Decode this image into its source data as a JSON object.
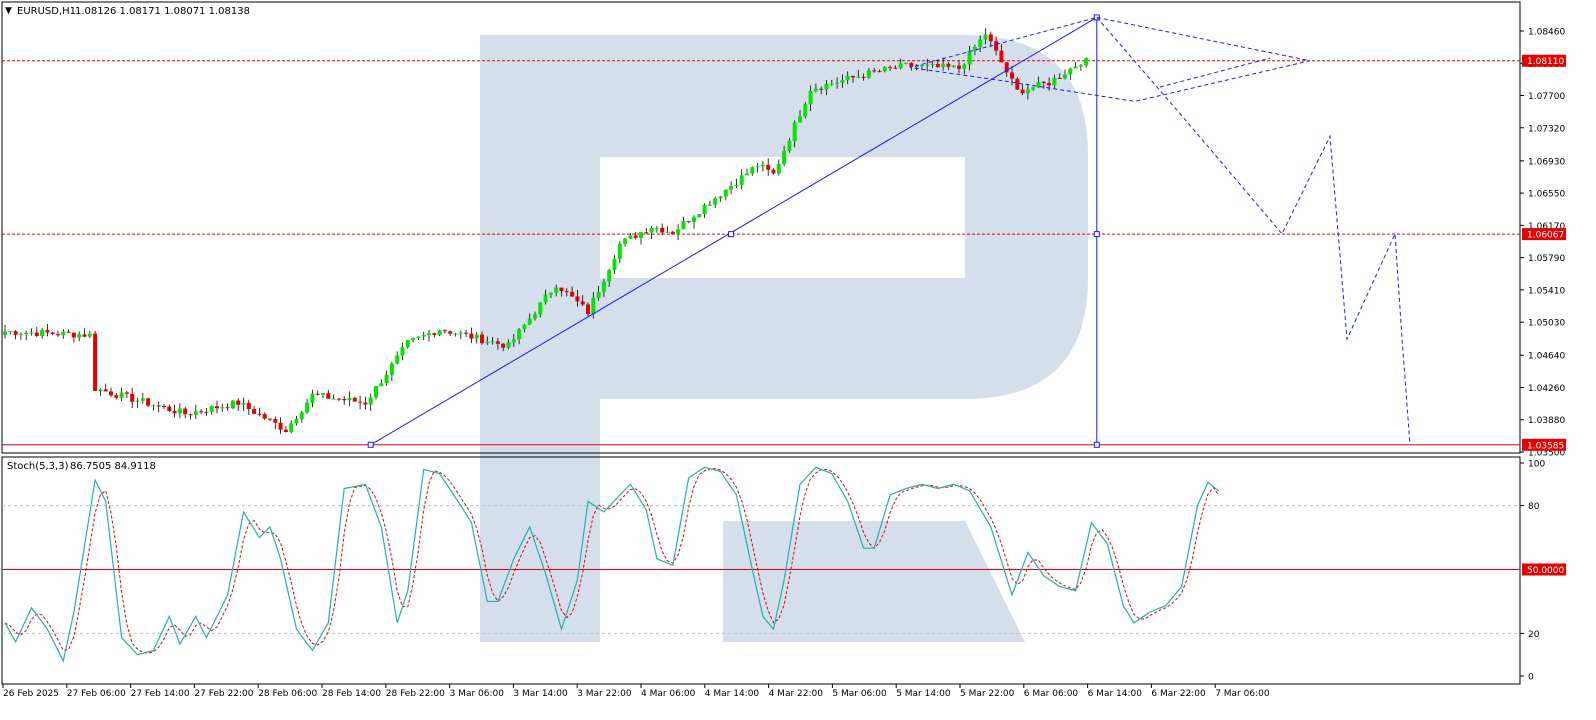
{
  "symbol_header": {
    "symbol": "EURUSD,H1",
    "ohlc": "1.08126 1.08171 1.08071 1.08138"
  },
  "stoch_header": {
    "label": "Stoch(5,3,3)",
    "values": "86.7505 84.9118"
  },
  "price_ticks": [
    "1.08460",
    "1.08080",
    "1.07700",
    "1.07320",
    "1.06930",
    "1.06550",
    "1.06170",
    "1.05790",
    "1.05410",
    "1.05030",
    "1.04640",
    "1.04260",
    "1.03880",
    "1.03500"
  ],
  "price_tick_values": [
    1.0846,
    1.0808,
    1.077,
    1.0732,
    1.0693,
    1.0655,
    1.0617,
    1.0579,
    1.0541,
    1.0503,
    1.0464,
    1.0426,
    1.0388,
    1.035
  ],
  "price_levels": [
    {
      "label": "1.08110",
      "value": 1.0811,
      "color": "#e60000"
    },
    {
      "label": "1.06067",
      "value": 1.06067,
      "color": "#e60000"
    },
    {
      "label": "1.03585",
      "value": 1.03585,
      "color": "#e60000"
    }
  ],
  "stoch_ticks": [
    "100",
    "80",
    "20",
    "0"
  ],
  "stoch_tick_values": [
    100,
    80,
    20,
    0
  ],
  "stoch_mid_label": "50.0000",
  "time_labels": [
    "26 Feb 2025",
    "27 Feb 06:00",
    "27 Feb 14:00",
    "27 Feb 22:00",
    "28 Feb 06:00",
    "28 Feb 14:00",
    "28 Feb 22:00",
    "3 Mar 06:00",
    "3 Mar 14:00",
    "3 Mar 22:00",
    "4 Mar 06:00",
    "4 Mar 14:00",
    "4 Mar 22:00",
    "5 Mar 06:00",
    "5 Mar 14:00",
    "5 Mar 22:00",
    "6 Mar 06:00",
    "6 Mar 14:00",
    "6 Mar 22:00",
    "7 Mar 06:00"
  ],
  "colors": {
    "bull": "#00e600",
    "bear": "#e60000",
    "trend": "#1a1aff",
    "stoch_main": "#20b2aa",
    "stoch_signal": "#e60000",
    "watermark": "#d5dfec"
  },
  "chart_data": {
    "type": "candlestick",
    "symbol": "EURUSD",
    "timeframe": "H1",
    "price_axis_range": [
      1.035,
      1.0862
    ],
    "key_points": [
      {
        "time": "28 Feb 17:00",
        "price": 1.03585
      },
      {
        "time": "4 Mar 18:00",
        "price": 1.06067
      },
      {
        "time": "6 Mar 11:00",
        "price": 1.0862
      }
    ],
    "forecast_path": [
      1.0811,
      1.0735,
      1.0607,
      1.0722,
      1.0483,
      1.0607,
      1.0484,
      1.0359
    ],
    "close_path_anchors": [
      {
        "bar": 0,
        "close": 1.0492
      },
      {
        "bar": 16,
        "close": 1.0488
      },
      {
        "bar": 17,
        "close": 1.0425
      },
      {
        "bar": 34,
        "close": 1.0395
      },
      {
        "bar": 44,
        "close": 1.0408
      },
      {
        "bar": 53,
        "close": 1.0376
      },
      {
        "bar": 58,
        "close": 1.0417
      },
      {
        "bar": 68,
        "close": 1.0408
      },
      {
        "bar": 76,
        "close": 1.0478
      },
      {
        "bar": 82,
        "close": 1.0495
      },
      {
        "bar": 95,
        "close": 1.0475
      },
      {
        "bar": 104,
        "close": 1.0548
      },
      {
        "bar": 110,
        "close": 1.0515
      },
      {
        "bar": 116,
        "close": 1.0595
      },
      {
        "bar": 122,
        "close": 1.0616
      },
      {
        "bar": 126,
        "close": 1.0609
      },
      {
        "bar": 133,
        "close": 1.0645
      },
      {
        "bar": 142,
        "close": 1.0688
      },
      {
        "bar": 145,
        "close": 1.0677
      },
      {
        "bar": 152,
        "close": 1.0778
      },
      {
        "bar": 163,
        "close": 1.0796
      },
      {
        "bar": 170,
        "close": 1.0805
      },
      {
        "bar": 180,
        "close": 1.0802
      },
      {
        "bar": 185,
        "close": 1.0843
      },
      {
        "bar": 191,
        "close": 1.0775
      },
      {
        "bar": 197,
        "close": 1.0785
      },
      {
        "bar": 204,
        "close": 1.0814
      }
    ],
    "stoch_axis_range": [
      0,
      100
    ],
    "stoch_levels": [
      80,
      50,
      20
    ],
    "stoch_last": {
      "main": 86.7505,
      "signal": 84.9118
    },
    "stoch_anchors": [
      {
        "bar": 0,
        "k": 25
      },
      {
        "bar": 2,
        "k": 16
      },
      {
        "bar": 5,
        "k": 32
      },
      {
        "bar": 8,
        "k": 22
      },
      {
        "bar": 11,
        "k": 7
      },
      {
        "bar": 13,
        "k": 30
      },
      {
        "bar": 17,
        "k": 92
      },
      {
        "bar": 19,
        "k": 82
      },
      {
        "bar": 22,
        "k": 18
      },
      {
        "bar": 25,
        "k": 10
      },
      {
        "bar": 28,
        "k": 12
      },
      {
        "bar": 31,
        "k": 28
      },
      {
        "bar": 33,
        "k": 15
      },
      {
        "bar": 36,
        "k": 28
      },
      {
        "bar": 38,
        "k": 18
      },
      {
        "bar": 42,
        "k": 38
      },
      {
        "bar": 45,
        "k": 77
      },
      {
        "bar": 48,
        "k": 65
      },
      {
        "bar": 50,
        "k": 70
      },
      {
        "bar": 52,
        "k": 55
      },
      {
        "bar": 55,
        "k": 22
      },
      {
        "bar": 58,
        "k": 12
      },
      {
        "bar": 61,
        "k": 25
      },
      {
        "bar": 64,
        "k": 88
      },
      {
        "bar": 68,
        "k": 90
      },
      {
        "bar": 71,
        "k": 70
      },
      {
        "bar": 74,
        "k": 25
      },
      {
        "bar": 76,
        "k": 40
      },
      {
        "bar": 79,
        "k": 97
      },
      {
        "bar": 82,
        "k": 95
      },
      {
        "bar": 86,
        "k": 80
      },
      {
        "bar": 88,
        "k": 72
      },
      {
        "bar": 91,
        "k": 35
      },
      {
        "bar": 93,
        "k": 35
      },
      {
        "bar": 96,
        "k": 55
      },
      {
        "bar": 99,
        "k": 70
      },
      {
        "bar": 102,
        "k": 48
      },
      {
        "bar": 105,
        "k": 22
      },
      {
        "bar": 108,
        "k": 45
      },
      {
        "bar": 110,
        "k": 82
      },
      {
        "bar": 113,
        "k": 77
      },
      {
        "bar": 116,
        "k": 85
      },
      {
        "bar": 118,
        "k": 90
      },
      {
        "bar": 121,
        "k": 78
      },
      {
        "bar": 123,
        "k": 55
      },
      {
        "bar": 126,
        "k": 52
      },
      {
        "bar": 129,
        "k": 93
      },
      {
        "bar": 132,
        "k": 98
      },
      {
        "bar": 135,
        "k": 96
      },
      {
        "bar": 138,
        "k": 85
      },
      {
        "bar": 141,
        "k": 50
      },
      {
        "bar": 143,
        "k": 28
      },
      {
        "bar": 145,
        "k": 22
      },
      {
        "bar": 147,
        "k": 45
      },
      {
        "bar": 150,
        "k": 90
      },
      {
        "bar": 153,
        "k": 98
      },
      {
        "bar": 156,
        "k": 95
      },
      {
        "bar": 159,
        "k": 82
      },
      {
        "bar": 162,
        "k": 60
      },
      {
        "bar": 164,
        "k": 60
      },
      {
        "bar": 167,
        "k": 85
      },
      {
        "bar": 170,
        "k": 88
      },
      {
        "bar": 173,
        "k": 90
      },
      {
        "bar": 176,
        "k": 88
      },
      {
        "bar": 179,
        "k": 90
      },
      {
        "bar": 182,
        "k": 87
      },
      {
        "bar": 186,
        "k": 70
      },
      {
        "bar": 190,
        "k": 38
      },
      {
        "bar": 193,
        "k": 58
      },
      {
        "bar": 196,
        "k": 47
      },
      {
        "bar": 199,
        "k": 42
      },
      {
        "bar": 202,
        "k": 40
      },
      {
        "bar": 205,
        "k": 72
      },
      {
        "bar": 208,
        "k": 62
      },
      {
        "bar": 211,
        "k": 33
      },
      {
        "bar": 213,
        "k": 25
      },
      {
        "bar": 216,
        "k": 30
      },
      {
        "bar": 219,
        "k": 33
      },
      {
        "bar": 222,
        "k": 42
      },
      {
        "bar": 225,
        "k": 80
      },
      {
        "bar": 227,
        "k": 91
      },
      {
        "bar": 229,
        "k": 86.75
      }
    ]
  }
}
